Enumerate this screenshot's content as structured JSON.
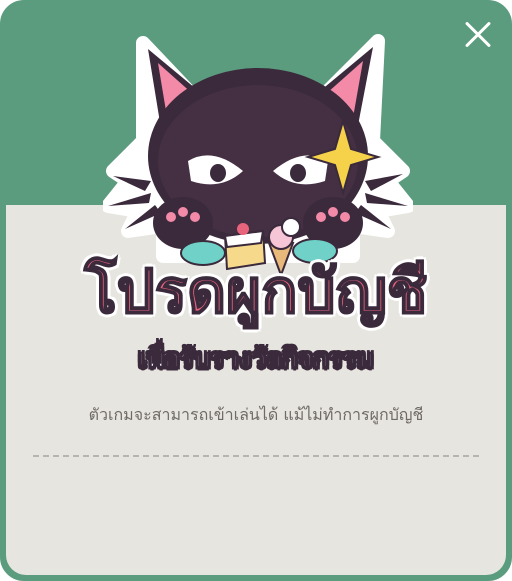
{
  "dialog": {
    "close_icon": "close-icon",
    "mascot_icon": "black-cat-mascot-icon",
    "title": "โปรดผูกบัญชี",
    "subtitle": "เพื่อรับรางวัลกิจกรรม",
    "description": "ตัวเกมจะสามารถเข้าเล่นได้ แม้ไม่ทำการผูกบัญชี"
  },
  "colors": {
    "header_green": "#5b9b7e",
    "panel_bg": "#e7e5e0",
    "title_pink": "#e8637c",
    "outline_dark": "#3a2a3c",
    "text_gray": "#6f6a67"
  }
}
